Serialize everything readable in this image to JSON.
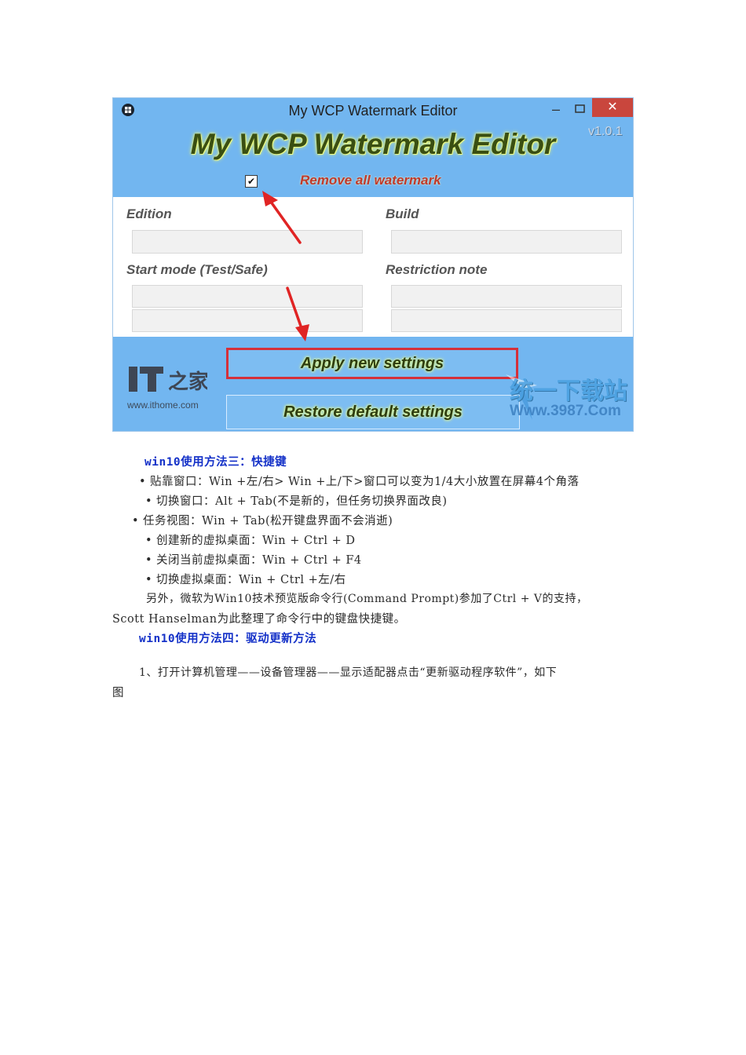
{
  "app": {
    "window_title": "My WCP Watermark Editor",
    "minimize_glyph": "–",
    "close_glyph": "✕",
    "big_title": "My WCP Watermark Editor",
    "version": "v1.0.1",
    "remove_checkbox_checked": true,
    "remove_label": "Remove all watermark",
    "labels": {
      "edition": "Edition",
      "build": "Build",
      "start_mode": "Start mode (Test/Safe)",
      "restriction_note": "Restriction note"
    },
    "apply_button": "Apply new settings",
    "restore_button": "Restore default settings",
    "ithome_url": "www.ithome.com",
    "watermark_cn": "统一下载站",
    "watermark_url": "Www.3987.Com",
    "colors": {
      "band": "#72b6f0",
      "close": "#c9463d",
      "highlight": "#d5303a"
    }
  },
  "doc": {
    "heading3": "win10使用方法三：快捷键",
    "bullets": [
      "贴靠窗口：Win +左/右> Win +上/下>窗口可以变为1/4大小放置在屏幕4个角落",
      "切换窗口：Alt + Tab(不是新的，但任务切换界面改良)",
      "任务视图：Win + Tab(松开键盘界面不会消逝)",
      "创建新的虚拟桌面：Win + Ctrl + D",
      "关闭当前虚拟桌面：Win + Ctrl + F4",
      "切换虚拟桌面：Win + Ctrl +左/右"
    ],
    "para_line1": "另外，微软为Win10技术预览版命令行(Command Prompt)参加了Ctrl + V的支持，",
    "para_line2": "Scott Hanselman为此整理了命令行中的键盘快捷键。",
    "heading4": "win10使用方法四：驱动更新方法",
    "step_line1": "1、打开计算机管理——设备管理器——显示适配器点击“更新驱动程序软件”，如下",
    "step_line2": "图"
  }
}
